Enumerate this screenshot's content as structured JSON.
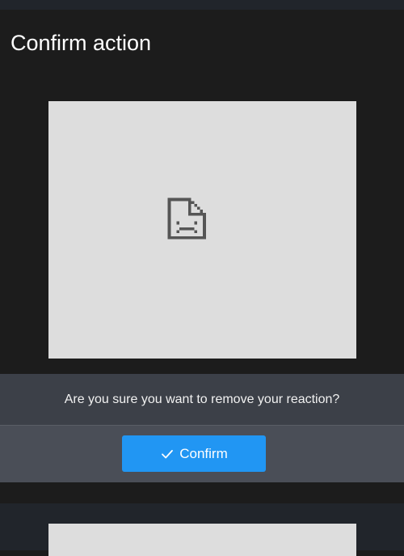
{
  "dialog": {
    "title": "Confirm action",
    "image_icon": "broken-image-icon",
    "message": "Are you sure you want to remove your reaction?",
    "confirm_label": "Confirm",
    "confirm_icon": "check-icon"
  },
  "colors": {
    "background": "#1c1c1c",
    "image_placeholder": "#dddddd",
    "message_bar": "#3c4048",
    "action_bar": "#4a4e57",
    "accent": "#2196f3"
  }
}
